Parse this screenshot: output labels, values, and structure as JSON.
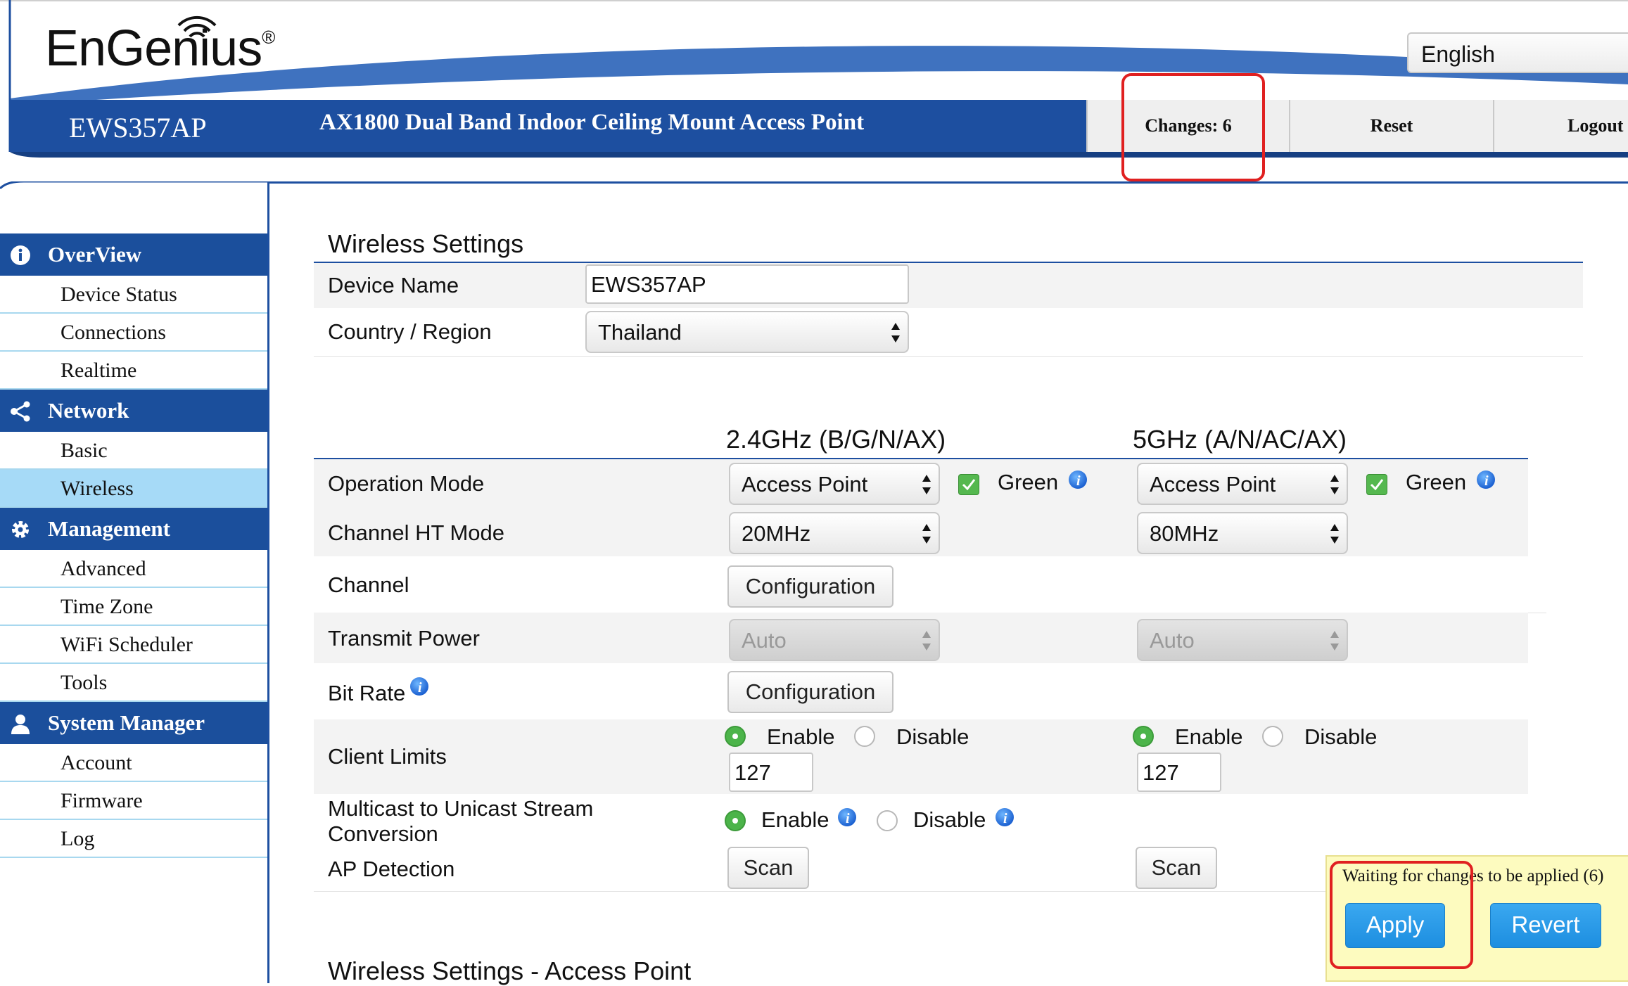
{
  "header": {
    "logo_text": "EnGenius",
    "logo_reg": "®",
    "language": "English",
    "model": "EWS357AP",
    "product": "AX1800 Dual Band Indoor Ceiling Mount Access Point",
    "changes_label": "Changes: 6",
    "reset_label": "Reset",
    "logout_label": "Logout"
  },
  "sidebar": {
    "sections": [
      {
        "title": "OverView",
        "icon": "info-icon",
        "items": [
          "Device Status",
          "Connections",
          "Realtime"
        ]
      },
      {
        "title": "Network",
        "icon": "share-icon",
        "items": [
          "Basic",
          "Wireless"
        ]
      },
      {
        "title": "Management",
        "icon": "gear-icon",
        "items": [
          "Advanced",
          "Time Zone",
          "WiFi Scheduler",
          "Tools"
        ]
      },
      {
        "title": "System Manager",
        "icon": "user-icon",
        "items": [
          "Account",
          "Firmware",
          "Log"
        ]
      }
    ],
    "active_item": "Wireless"
  },
  "wireless": {
    "title": "Wireless Settings",
    "device_name_label": "Device Name",
    "device_name_value": "EWS357AP",
    "country_label": "Country / Region",
    "country_value": "Thailand",
    "band_24_title": "2.4GHz (B/G/N/AX)",
    "band_5_title": "5GHz (A/N/AC/AX)",
    "operation_mode_label": "Operation Mode",
    "op_mode_24": "Access Point",
    "op_mode_5": "Access Point",
    "green_label": "Green",
    "ht_mode_label": "Channel HT Mode",
    "ht_mode_24": "20MHz",
    "ht_mode_5": "80MHz",
    "channel_label": "Channel",
    "configuration_label": "Configuration",
    "tx_power_label": "Transmit Power",
    "tx_power_24": "Auto",
    "tx_power_5": "Auto",
    "bit_rate_label": "Bit Rate",
    "client_limits_label": "Client Limits",
    "enable_label": "Enable",
    "disable_label": "Disable",
    "client_limit_24": "127",
    "client_limit_5": "127",
    "multicast_label_1": "Multicast to Unicast Stream",
    "multicast_label_2": "Conversion",
    "ap_detection_label": "AP Detection",
    "scan_label": "Scan",
    "next_section_title": "Wireless Settings - Access Point"
  },
  "apply_panel": {
    "message": "Waiting for changes to be applied (6)",
    "apply_label": "Apply",
    "revert_label": "Revert"
  },
  "colors": {
    "brand_blue": "#1b4f9c",
    "active_item": "#a6daf7",
    "highlight_red": "#e02020",
    "apply_blue": "#1d8ee0",
    "check_green": "#55b84f"
  }
}
